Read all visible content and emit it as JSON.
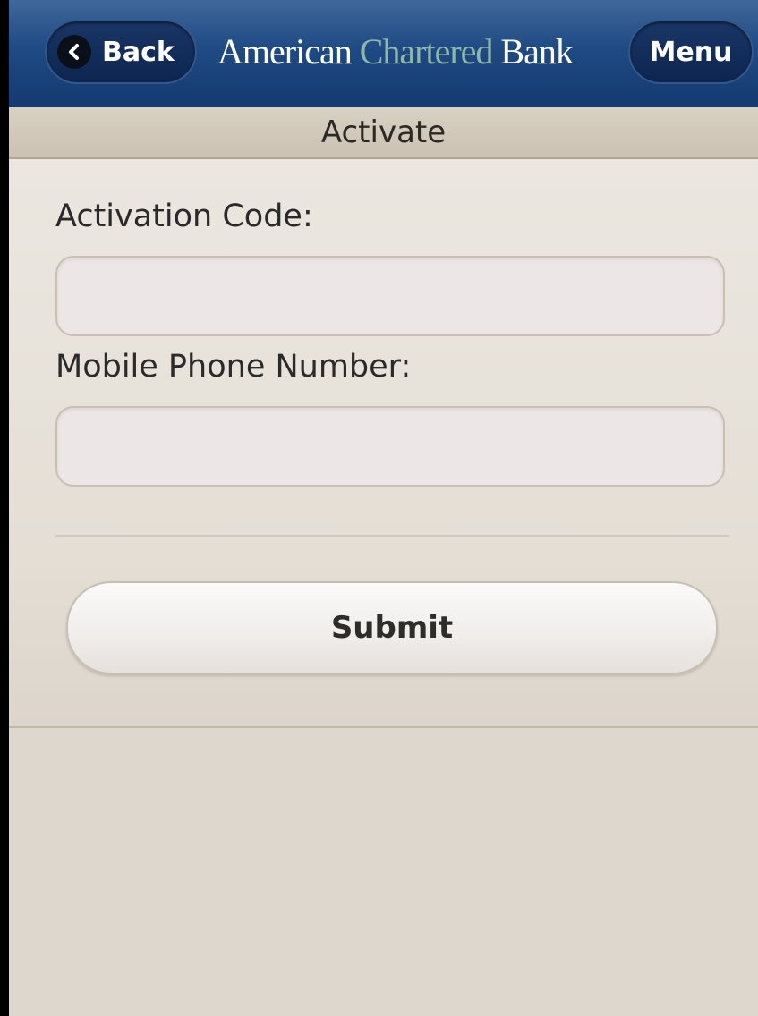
{
  "header": {
    "back_label": "Back",
    "menu_label": "Menu",
    "logo": {
      "part1": "American ",
      "part2": "Chartered",
      "part3": " Bank"
    },
    "colors": {
      "bar": "#1f4a84",
      "logo_accent": "#8fb7a8"
    }
  },
  "page": {
    "title": "Activate"
  },
  "form": {
    "activation_code_label": "Activation Code:",
    "activation_code_value": "",
    "mobile_phone_label": "Mobile Phone Number:",
    "mobile_phone_value": "",
    "submit_label": "Submit"
  },
  "icons": {
    "back": "chevron-left-icon"
  }
}
